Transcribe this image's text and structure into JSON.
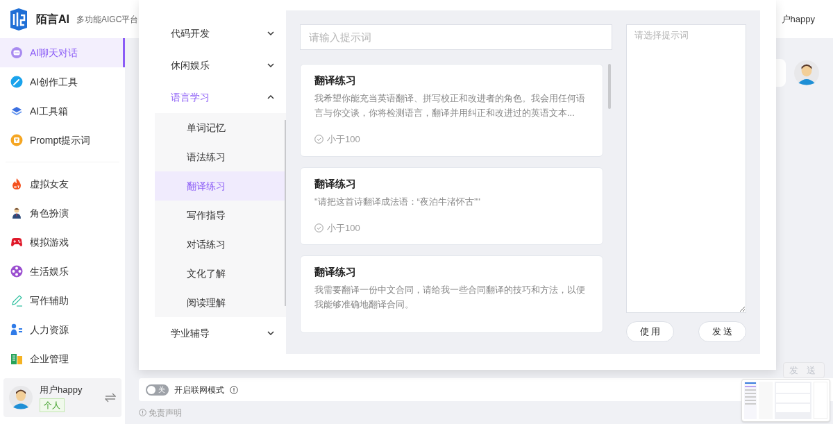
{
  "brand": {
    "name": "陌言AI",
    "tagline": "多功能AIGC平台"
  },
  "nav_groups": [
    [
      {
        "label": "AI聊天对话",
        "kind": "chat",
        "selected": true
      },
      {
        "label": "AI创作工具",
        "kind": "pen",
        "selected": false
      },
      {
        "label": "AI工具箱",
        "kind": "layers",
        "selected": false
      },
      {
        "label": "Prompt提示词",
        "kind": "prompt",
        "selected": false
      }
    ],
    [
      {
        "label": "虚拟女友",
        "kind": "fire",
        "selected": false
      },
      {
        "label": "角色扮演",
        "kind": "person",
        "selected": false
      },
      {
        "label": "模拟游戏",
        "kind": "gamepad",
        "selected": false
      },
      {
        "label": "生活娱乐",
        "kind": "film",
        "selected": false
      },
      {
        "label": "写作辅助",
        "kind": "pencil",
        "selected": false
      },
      {
        "label": "人力资源",
        "kind": "people",
        "selected": false
      },
      {
        "label": "企业管理",
        "kind": "building",
        "selected": false
      }
    ]
  ],
  "user": {
    "name": "用户happy",
    "tag": "个人"
  },
  "header_user": "户happy",
  "categories": [
    {
      "label": "代码开发",
      "expanded": false
    },
    {
      "label": "休闲娱乐",
      "expanded": false
    },
    {
      "label": "语言学习",
      "expanded": true,
      "children": [
        {
          "label": "单词记忆",
          "selected": false
        },
        {
          "label": "语法练习",
          "selected": false
        },
        {
          "label": "翻译练习",
          "selected": true
        },
        {
          "label": "写作指导",
          "selected": false
        },
        {
          "label": "对话练习",
          "selected": false
        },
        {
          "label": "文化了解",
          "selected": false
        },
        {
          "label": "阅读理解",
          "selected": false
        }
      ]
    },
    {
      "label": "学业辅导",
      "expanded": false
    }
  ],
  "search": {
    "placeholder": "请输入提示词"
  },
  "cards": [
    {
      "title": "翻译练习",
      "description": "我希望你能充当英语翻译、拼写校正和改进者的角色。我会用任何语言与你交谈，你将检测语言，翻译并用纠正和改进过的英语文本...",
      "footer": "小于100"
    },
    {
      "title": "翻译练习",
      "description": "\"请把这首诗翻译成法语：“夜泊牛渚怀古”\"",
      "footer": "小于100"
    },
    {
      "title": "翻译练习",
      "description": "我需要翻译一份中文合同，请给我一些合同翻译的技巧和方法，以便我能够准确地翻译合同。"
    }
  ],
  "preview": {
    "placeholder": "请选择提示词"
  },
  "buttons": [
    "使 用",
    "发 送"
  ],
  "network_toggle": {
    "on": false,
    "state_label": "关",
    "label": "开启联网模式"
  },
  "disclaimer": "免责声明",
  "send_button": {
    "label": "发 送",
    "disabled": true
  }
}
